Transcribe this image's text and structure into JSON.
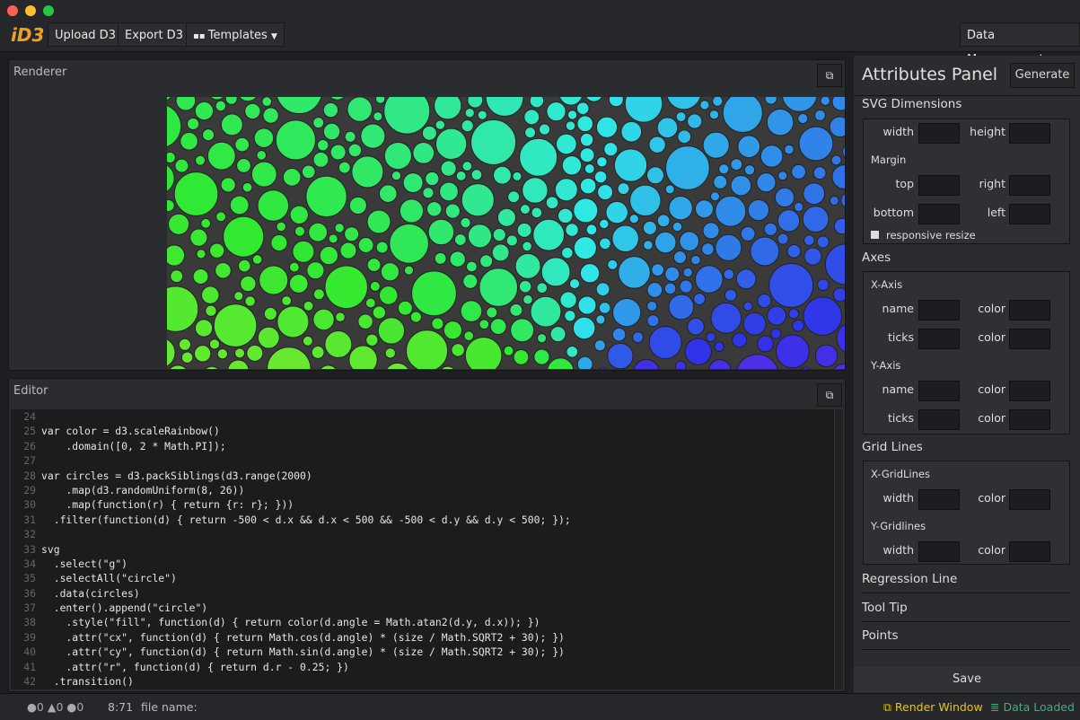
{
  "toolbar": {
    "logo": "iD3",
    "upload": "Upload D3",
    "export": "Export D3",
    "templates": "Templates",
    "data_management": "Data Management"
  },
  "renderer": {
    "title": "Renderer"
  },
  "editor": {
    "title": "Editor",
    "lines": [
      {
        "n": "24",
        "t": ""
      },
      {
        "n": "25",
        "t": "var color = d3.scaleRainbow()"
      },
      {
        "n": "26",
        "t": "    .domain([0, 2 * Math.PI]);"
      },
      {
        "n": "27",
        "t": ""
      },
      {
        "n": "28",
        "t": "var circles = d3.packSiblings(d3.range(2000)"
      },
      {
        "n": "29",
        "t": "    .map(d3.randomUniform(8, 26))"
      },
      {
        "n": "30",
        "t": "    .map(function(r) { return {r: r}; }))"
      },
      {
        "n": "31",
        "t": "  .filter(function(d) { return -500 < d.x && d.x < 500 && -500 < d.y && d.y < 500; });"
      },
      {
        "n": "32",
        "t": ""
      },
      {
        "n": "33",
        "t": "svg"
      },
      {
        "n": "34",
        "t": "  .select(\"g\")"
      },
      {
        "n": "35",
        "t": "  .selectAll(\"circle\")"
      },
      {
        "n": "36",
        "t": "  .data(circles)"
      },
      {
        "n": "37",
        "t": "  .enter().append(\"circle\")"
      },
      {
        "n": "38",
        "t": "    .style(\"fill\", function(d) { return color(d.angle = Math.atan2(d.y, d.x)); })"
      },
      {
        "n": "39",
        "t": "    .attr(\"cx\", function(d) { return Math.cos(d.angle) * (size / Math.SQRT2 + 30); })"
      },
      {
        "n": "40",
        "t": "    .attr(\"cy\", function(d) { return Math.sin(d.angle) * (size / Math.SQRT2 + 30); })"
      },
      {
        "n": "41",
        "t": "    .attr(\"r\", function(d) { return d.r - 0.25; })"
      },
      {
        "n": "42",
        "t": "  .transition()"
      }
    ]
  },
  "attributes": {
    "title": "Attributes Panel",
    "generate": "Generate",
    "svg_dimensions": "SVG Dimensions",
    "width": "width",
    "height": "height",
    "margin": "Margin",
    "top": "top",
    "right": "right",
    "bottom": "bottom",
    "left": "left",
    "responsive": "responsive resize",
    "axes": "Axes",
    "x_axis": "X-Axis",
    "y_axis": "Y-Axis",
    "name": "name",
    "color": "color",
    "ticks": "ticks",
    "grid_lines": "Grid Lines",
    "x_grid": "X-GridLines",
    "y_grid": "Y-Gridlines",
    "regression": "Regression Line",
    "tooltip": "Tool Tip",
    "points": "Points",
    "save": "Save"
  },
  "status": {
    "errors": "0",
    "warnings": "0",
    "infos": "0",
    "cursor": "8:71",
    "file_label": "file name:",
    "render_window": "Render Window",
    "data_loaded": "Data Loaded",
    "render_color": "#e8c51c",
    "data_color": "#3fb07a"
  }
}
